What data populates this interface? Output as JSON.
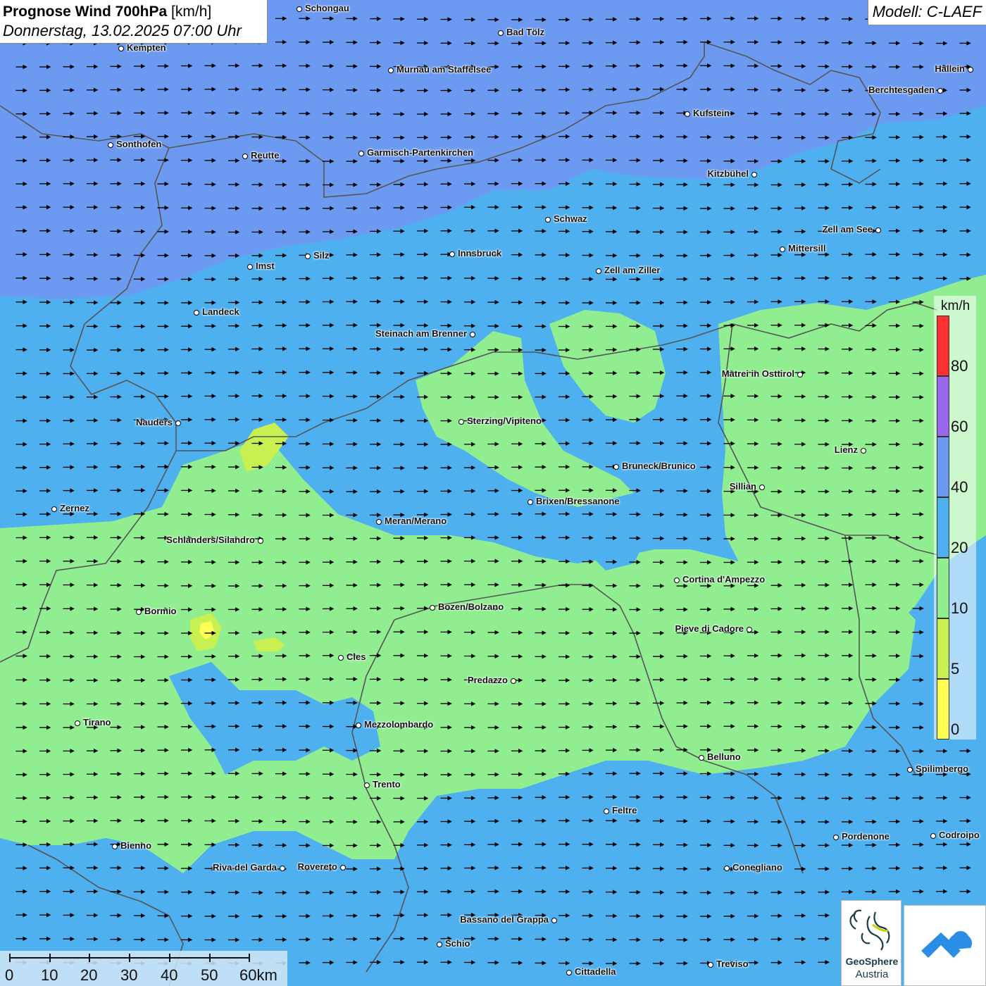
{
  "header": {
    "title_bold": "Prognose Wind 700hPa",
    "title_unit": " [km/h]",
    "datetime": "Donnerstag, 13.02.2025 07:00 Uhr",
    "model": "Modell: C-LAEF"
  },
  "colors": {
    "band_0_5": "#ffff55",
    "band_5_10": "#c8f050",
    "band_10_20": "#90ee90",
    "band_20_40": "#4fb0ef",
    "band_40_60": "#6c9af0",
    "band_60_80": "#9a66ee",
    "band_80_plus": "#ff3030",
    "borders": "#555555",
    "arrows": "#000000"
  },
  "legend": {
    "unit": "km/h",
    "ticks": [
      "80",
      "60",
      "40",
      "20",
      "10",
      "5",
      "0"
    ]
  },
  "scale": {
    "ticks": [
      "0",
      "10",
      "20",
      "30",
      "40",
      "50",
      "60km"
    ]
  },
  "wind": {
    "direction": "west-southwest flow, arrows pointing east-northeast"
  },
  "cities": [
    {
      "name": "Schongau",
      "side": "right"
    },
    {
      "name": "Bad Tölz",
      "side": "right"
    },
    {
      "name": "Kempten",
      "side": "right"
    },
    {
      "name": "Murnau am Staffelsee",
      "side": "right"
    },
    {
      "name": "Hallein",
      "side": "left"
    },
    {
      "name": "Berchtesgaden",
      "side": "left"
    },
    {
      "name": "Kufstein",
      "side": "right"
    },
    {
      "name": "Sonthofen",
      "side": "right"
    },
    {
      "name": "Reutte",
      "side": "right"
    },
    {
      "name": "Garmisch-Partenkirchen",
      "side": "right"
    },
    {
      "name": "Kitzbühel",
      "side": "left"
    },
    {
      "name": "Schwaz",
      "side": "right"
    },
    {
      "name": "Zell am See",
      "side": "left"
    },
    {
      "name": "Mittersill",
      "side": "right"
    },
    {
      "name": "Innsbruck",
      "side": "right"
    },
    {
      "name": "Silz",
      "side": "right"
    },
    {
      "name": "Imst",
      "side": "right"
    },
    {
      "name": "Zell am Ziller",
      "side": "right"
    },
    {
      "name": "Landeck",
      "side": "right"
    },
    {
      "name": "Steinach am Brenner",
      "side": "left"
    },
    {
      "name": "Matrei in Osttirol",
      "side": "left"
    },
    {
      "name": "Nauders",
      "side": "left"
    },
    {
      "name": "Sterzing/Vipiteno",
      "side": "right"
    },
    {
      "name": "Lienz",
      "side": "left"
    },
    {
      "name": "Bruneck/Brunico",
      "side": "right"
    },
    {
      "name": "Sillian",
      "side": "left"
    },
    {
      "name": "Zernez",
      "side": "right"
    },
    {
      "name": "Brixen/Bressanone",
      "side": "right"
    },
    {
      "name": "Meran/Merano",
      "side": "right"
    },
    {
      "name": "Schlanders/Silandro",
      "side": "left"
    },
    {
      "name": "Cortina d'Ampezzo",
      "side": "right"
    },
    {
      "name": "Bozen/Bolzano",
      "side": "right"
    },
    {
      "name": "Bormio",
      "side": "right"
    },
    {
      "name": "Pieve di Cadore",
      "side": "left"
    },
    {
      "name": "Cles",
      "side": "right"
    },
    {
      "name": "Predazzo",
      "side": "left"
    },
    {
      "name": "Tirano",
      "side": "right"
    },
    {
      "name": "Mezzolombardo",
      "side": "right"
    },
    {
      "name": "Belluno",
      "side": "right"
    },
    {
      "name": "Spilimbergo",
      "side": "right"
    },
    {
      "name": "Trento",
      "side": "right"
    },
    {
      "name": "Feltre",
      "side": "right"
    },
    {
      "name": "Pordenone",
      "side": "right"
    },
    {
      "name": "Codroipo",
      "side": "right"
    },
    {
      "name": "Bienno",
      "side": "right"
    },
    {
      "name": "Riva del Garda",
      "side": "left"
    },
    {
      "name": "Rovereto",
      "side": "left"
    },
    {
      "name": "Conegliano",
      "side": "right"
    },
    {
      "name": "Bassano del Grappa",
      "side": "left"
    },
    {
      "name": "Schio",
      "side": "right"
    },
    {
      "name": "Treviso",
      "side": "right"
    },
    {
      "name": "Cittadella",
      "side": "right"
    }
  ],
  "logos": {
    "geosphere_name": "GeoSphere",
    "geosphere_sub": "Austria"
  }
}
